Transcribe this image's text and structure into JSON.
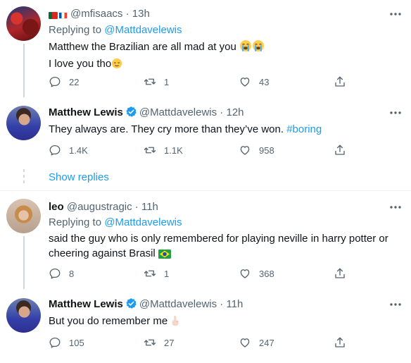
{
  "tweets": [
    {
      "author_name": "",
      "handle": "@mfisaacs",
      "time": "13h",
      "flags": [
        "portugal",
        "france"
      ],
      "replying_label": "Replying to ",
      "replying_to": "@Mattdavelewis",
      "text_line1": "Matthew the Brazilian are all mad at you",
      "text_line2": "I love you tho",
      "emoji_line1": [
        "loudly-crying-face",
        "loudly-crying-face"
      ],
      "emoji_line2": "relieved-face",
      "replies": "22",
      "retweets": "1",
      "likes": "43"
    },
    {
      "author_name": "Matthew Lewis",
      "handle": "@Mattdavelewis",
      "time": "12h",
      "verified": true,
      "text": "They always are. They cry more than they’ve won. ",
      "hashtag": "#boring",
      "replies": "1.4K",
      "retweets": "1.1K",
      "likes": "958"
    },
    {
      "author_name": "leo",
      "handle": "@augustragic",
      "time": "11h",
      "replying_label": "Replying to ",
      "replying_to": "@Mattdavelewis",
      "text_line1": "said the guy who is only remembered for playing neville in harry potter or",
      "text_line2": "cheering against Brasil",
      "emoji_line2": "brazil-flag",
      "replies": "8",
      "retweets": "1",
      "likes": "368"
    },
    {
      "author_name": "Matthew Lewis",
      "handle": "@Mattdavelewis",
      "time": "11h",
      "verified": true,
      "text": "But you do remember me",
      "emoji": "pointing-up-hand",
      "replies": "105",
      "retweets": "27",
      "likes": "247"
    }
  ],
  "show_replies": "Show replies",
  "separator": " · ",
  "colors": {
    "accent": "#1d9bf0",
    "muted": "#536471",
    "text": "#0f1419",
    "line": "#cfd9de"
  }
}
